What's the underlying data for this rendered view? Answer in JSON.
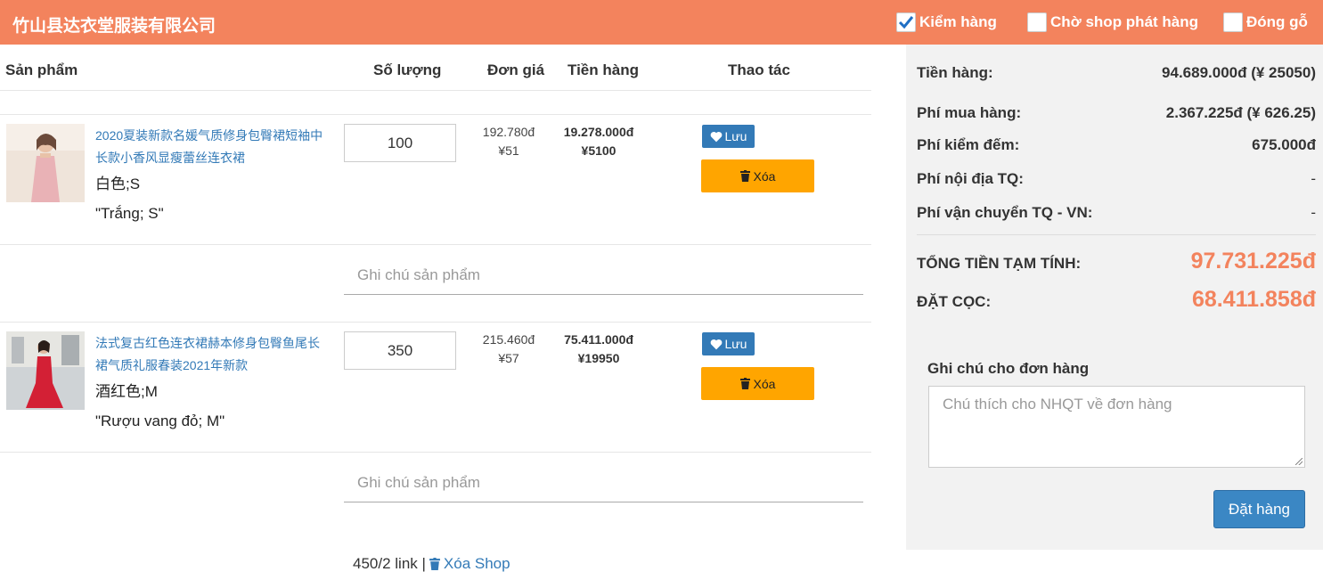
{
  "header": {
    "shop_name": "竹山县达衣堂服装有限公司",
    "options": [
      {
        "label": "Kiểm hàng",
        "checked": true
      },
      {
        "label": "Chờ shop phát hàng",
        "checked": false
      },
      {
        "label": "Đóng gỗ",
        "checked": false
      }
    ]
  },
  "table": {
    "headers": {
      "product": "Sản phẩm",
      "quantity": "Số lượng",
      "unit_price": "Đơn giá",
      "amount": "Tiền hàng",
      "actions": "Thao tác"
    }
  },
  "items": [
    {
      "title": "2020夏装新款名媛气质修身包臀裙短袖中长款小香风显瘦蕾丝连衣裙",
      "variant": "白色;S",
      "variant_vi": "\"Trắng; S\"",
      "quantity": "100",
      "price_vnd": "192.780đ",
      "price_cny": "¥51",
      "total_vnd": "19.278.000đ",
      "total_cny": "¥5100",
      "save_label": "Lưu",
      "delete_label": "Xóa",
      "note_placeholder": "Ghi chú sản phẩm"
    },
    {
      "title": "法式复古红色连衣裙赫本修身包臀鱼尾长裙气质礼服春装2021年新款",
      "variant": "酒红色;M",
      "variant_vi": "\"Rượu vang đỏ; M\"",
      "quantity": "350",
      "price_vnd": "215.460đ",
      "price_cny": "¥57",
      "total_vnd": "75.411.000đ",
      "total_cny": "¥19950",
      "save_label": "Lưu",
      "delete_label": "Xóa",
      "note_placeholder": "Ghi chú sản phẩm"
    }
  ],
  "footer": {
    "summary": "450/2 link |",
    "delete_shop": "Xóa Shop"
  },
  "summary": {
    "goods_label": "Tiền hàng:",
    "goods_value": "94.689.000đ (¥ 25050)",
    "purchase_fee_label": "Phí mua hàng:",
    "purchase_fee_value": "2.367.225đ (¥ 626.25)",
    "inspection_fee_label": "Phí kiểm đếm:",
    "inspection_fee_value": "675.000đ",
    "domestic_fee_label": "Phí nội địa TQ:",
    "domestic_fee_value": "-",
    "shipping_fee_label": "Phí vận chuyển TQ - VN:",
    "shipping_fee_value": "-",
    "total_label": "TỔNG TIỀN TẠM TÍNH:",
    "total_value": "97.731.225đ",
    "deposit_label": "ĐẶT CỌC:",
    "deposit_value": "68.411.858đ",
    "order_note_label": "Ghi chú cho đơn hàng",
    "order_note_placeholder": "Chú thích cho NHQT về đơn hàng",
    "order_button": "Đặt hàng"
  },
  "colors": {
    "header_bg": "#f3835d",
    "link": "#337ab7",
    "delete_btn": "#ffa500",
    "accent_total": "#f3835d",
    "panel_bg": "#f2f2f2"
  }
}
